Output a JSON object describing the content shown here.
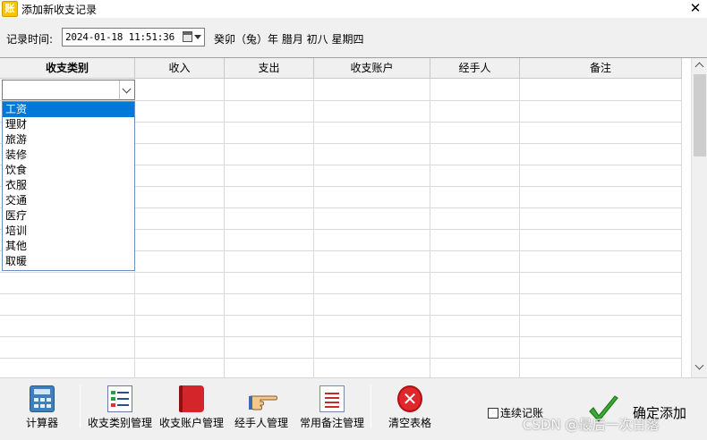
{
  "window": {
    "title": "添加新收支记录",
    "app_icon_text": "账",
    "close_glyph": "✕"
  },
  "record_time": {
    "label": "记录时间:",
    "value": "2024-01-18 11:51:36",
    "lunar": "癸卯（兔）年 腊月 初八 星期四"
  },
  "grid": {
    "columns": [
      "收支类别",
      "收入",
      "支出",
      "收支账户",
      "经手人",
      "备注"
    ],
    "category_value": "",
    "category_options": [
      "工资",
      "理财",
      "旅游",
      "装修",
      "饮食",
      "衣服",
      "交通",
      "医疗",
      "培训",
      "其他",
      "取暖"
    ],
    "selected_option": "工资"
  },
  "toolbar": {
    "calculator": "计算器",
    "category_mgmt": "收支类别管理",
    "account_mgmt": "收支账户管理",
    "handler_mgmt": "经手人管理",
    "remark_mgmt": "常用备注管理",
    "clear_table": "清空表格",
    "continuous_label": "连续记账",
    "confirm_label": "确定添加"
  },
  "watermark": "CSDN @最后一次日落",
  "colors": {
    "selection": "#0078d7",
    "clear_red": "#e0282c",
    "confirm_green": "#3aaa35"
  }
}
